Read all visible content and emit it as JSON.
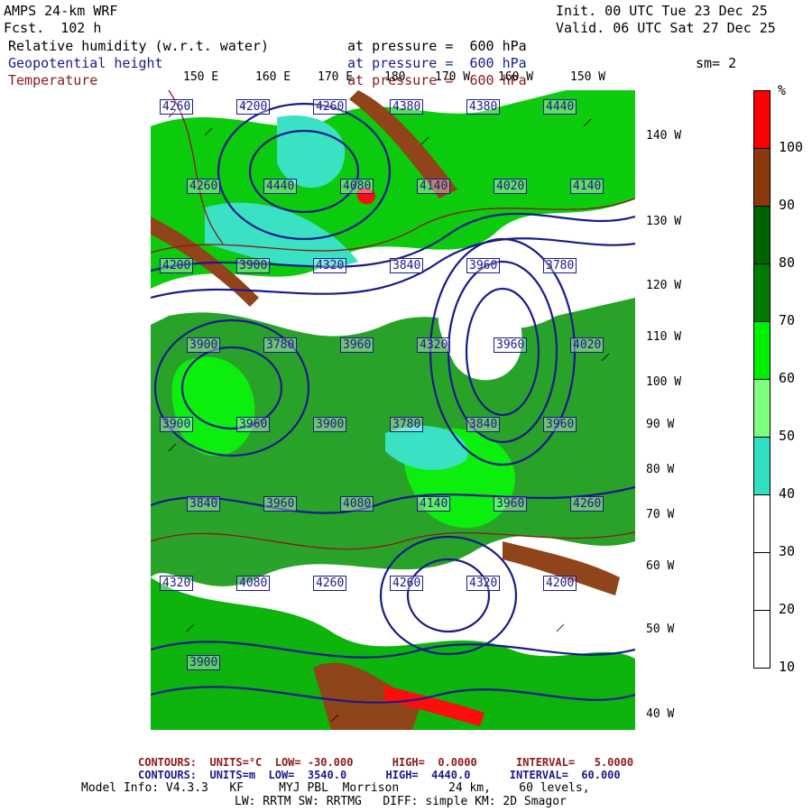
{
  "header": {
    "model": "AMPS 24-km WRF",
    "fcst": "Fcst.  102 h",
    "init": "Init. 00 UTC Tue 23 Dec 25",
    "valid": "Valid. 06 UTC Sat 27 Dec 25",
    "field1": "Relative humidity (w.r.t. water)",
    "field1_level": "at pressure =  600 hPa",
    "field2": "Geopotential height",
    "field2_level": "at pressure =  600 hPa",
    "field3": "Temperature",
    "field3_level": "at pressure =  600 hPa",
    "smoothing": "sm= 2"
  },
  "lon_labels": [
    "150 E",
    "160 E",
    "170 E",
    "180",
    "170 W",
    "160 W",
    "150 W"
  ],
  "lat_labels": [
    "140 W",
    "130 W",
    "120 W",
    "110 W",
    "100 W",
    "90 W",
    "80 W",
    "70 W",
    "60 W",
    "50 W",
    "40 W"
  ],
  "colorbar": {
    "unit": "%",
    "ticks": [
      "100",
      "90",
      "80",
      "70",
      "60",
      "50",
      "40",
      "30",
      "20",
      "10"
    ],
    "colors": [
      "#ff0000",
      "#8b3a0e",
      "#006400",
      "#007a00",
      "#00ee00",
      "#7fff7f",
      "#30e0c0",
      "#ffffff",
      "#ffffff",
      "#ffffff"
    ]
  },
  "height_labels": [
    "4260",
    "4200",
    "4260",
    "4380",
    "4380",
    "4440",
    "4260",
    "4440",
    "4080",
    "4140",
    "4020",
    "4140",
    "4200",
    "3900",
    "4320",
    "3840",
    "3960",
    "3780",
    "3900",
    "3780",
    "3960",
    "4320",
    "3960",
    "4020",
    "3900",
    "3960",
    "3900",
    "3780",
    "3840",
    "3960",
    "3840",
    "3960",
    "4080",
    "4140",
    "3960",
    "4260",
    "4320",
    "4080",
    "4260",
    "4260",
    "4320",
    "4200",
    "3900"
  ],
  "footer": {
    "red_line": "CONTOURS:  UNITS=°C  LOW= -30.000      HIGH=  0.0000      INTERVAL=   5.0000",
    "blue_line": "CONTOURS:  UNITS=m  LOW=  3540.0      HIGH=  4440.0      INTERVAL=  60.000",
    "info1": "Model Info: V4.3.3   KF     MYJ PBL  Morrison       24 km,    60 levels,",
    "info2": "LW: RRTM SW: RRTMG   DIFF: simple KM: 2D Smagor"
  }
}
